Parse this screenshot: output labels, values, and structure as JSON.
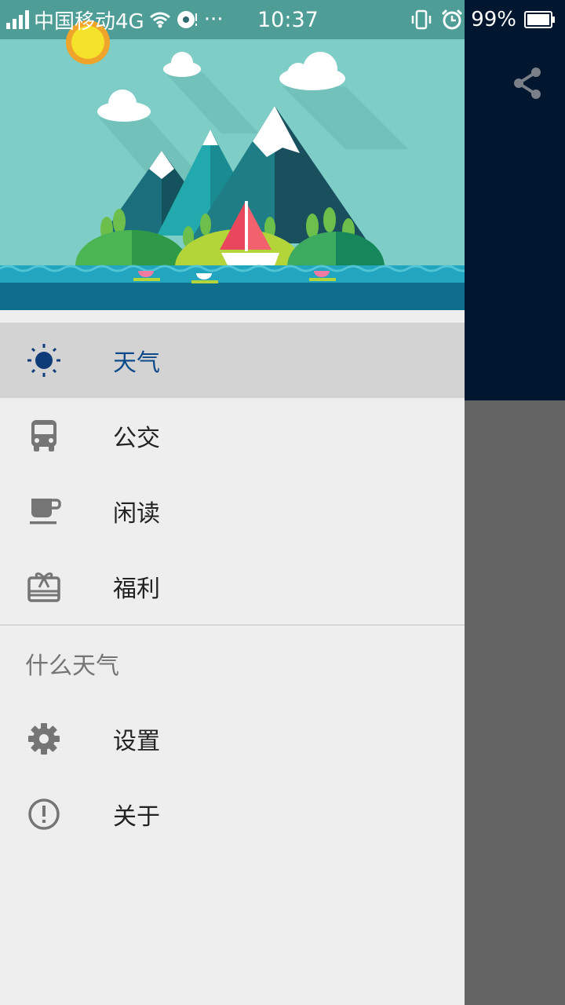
{
  "status_bar": {
    "carrier": "中国移动4G",
    "dots": "···",
    "time": "10:37",
    "battery": "99%"
  },
  "drawer": {
    "menu_primary": [
      {
        "label": "天气",
        "icon": "sun-icon",
        "selected": true
      },
      {
        "label": "公交",
        "icon": "bus-icon",
        "selected": false
      },
      {
        "label": "闲读",
        "icon": "coffee-cup-icon",
        "selected": false
      },
      {
        "label": "福利",
        "icon": "gift-card-icon",
        "selected": false
      }
    ],
    "section_title": "什么天气",
    "menu_secondary": [
      {
        "label": "设置",
        "icon": "gear-icon"
      },
      {
        "label": "关于",
        "icon": "info-circle-icon"
      }
    ]
  },
  "colors": {
    "toolbar_bg": "#00172f",
    "drawer_bg": "#eeeeee",
    "selected_bg": "#d3d3d3",
    "accent": "#0d4a8a",
    "sky": "#7ecdc6",
    "sea": "#0e6e8c"
  }
}
